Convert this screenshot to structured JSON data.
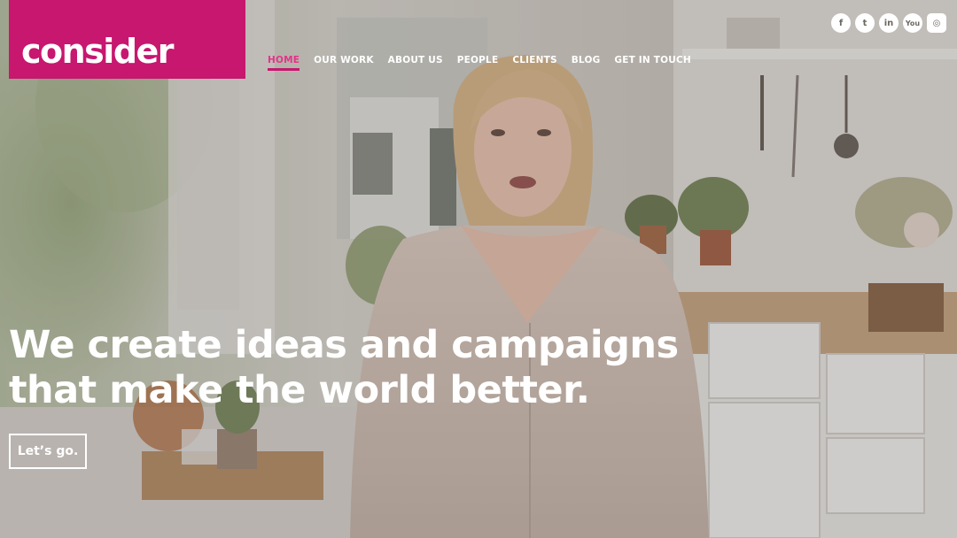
{
  "brand": {
    "logo_text": "consider",
    "accent_color": "#c7176f"
  },
  "nav": {
    "items": [
      {
        "label": "HOME",
        "active": true
      },
      {
        "label": "OUR WORK",
        "active": false
      },
      {
        "label": "ABOUT US",
        "active": false
      },
      {
        "label": "PEOPLE",
        "active": false
      },
      {
        "label": "CLIENTS",
        "active": false
      },
      {
        "label": "BLOG",
        "active": false
      },
      {
        "label": "GET IN TOUCH",
        "active": false
      }
    ]
  },
  "social": {
    "icons": [
      {
        "name": "facebook-icon",
        "glyph": "f"
      },
      {
        "name": "twitter-icon",
        "glyph": "t"
      },
      {
        "name": "linkedin-icon",
        "glyph": "in"
      },
      {
        "name": "youtube-icon",
        "glyph": "You"
      },
      {
        "name": "instagram-icon",
        "glyph": "◎"
      }
    ]
  },
  "hero": {
    "headline_line1": "We create ideas and campaigns",
    "headline_line2": "that make the world better.",
    "cta_label": "Let’s go.",
    "background_image": "woman-in-kitchen-photo"
  }
}
